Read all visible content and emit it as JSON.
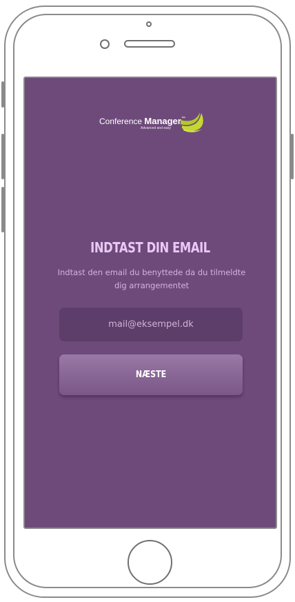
{
  "logo": {
    "brand_light": "Conference",
    "brand_bold": "Manager",
    "trademark": "™",
    "tagline": "Advanced and easy",
    "swoosh_color": "#c5d832"
  },
  "screen": {
    "background_color": "#6e4a7b",
    "heading": "INDTAST DIN EMAIL",
    "subtitle": "Indtast den email du benyttede da du tilmeldte dig arrangementet"
  },
  "email_field": {
    "value": "",
    "placeholder": "mail@eksempel.dk"
  },
  "next_button": {
    "label": "NÆSTE"
  }
}
